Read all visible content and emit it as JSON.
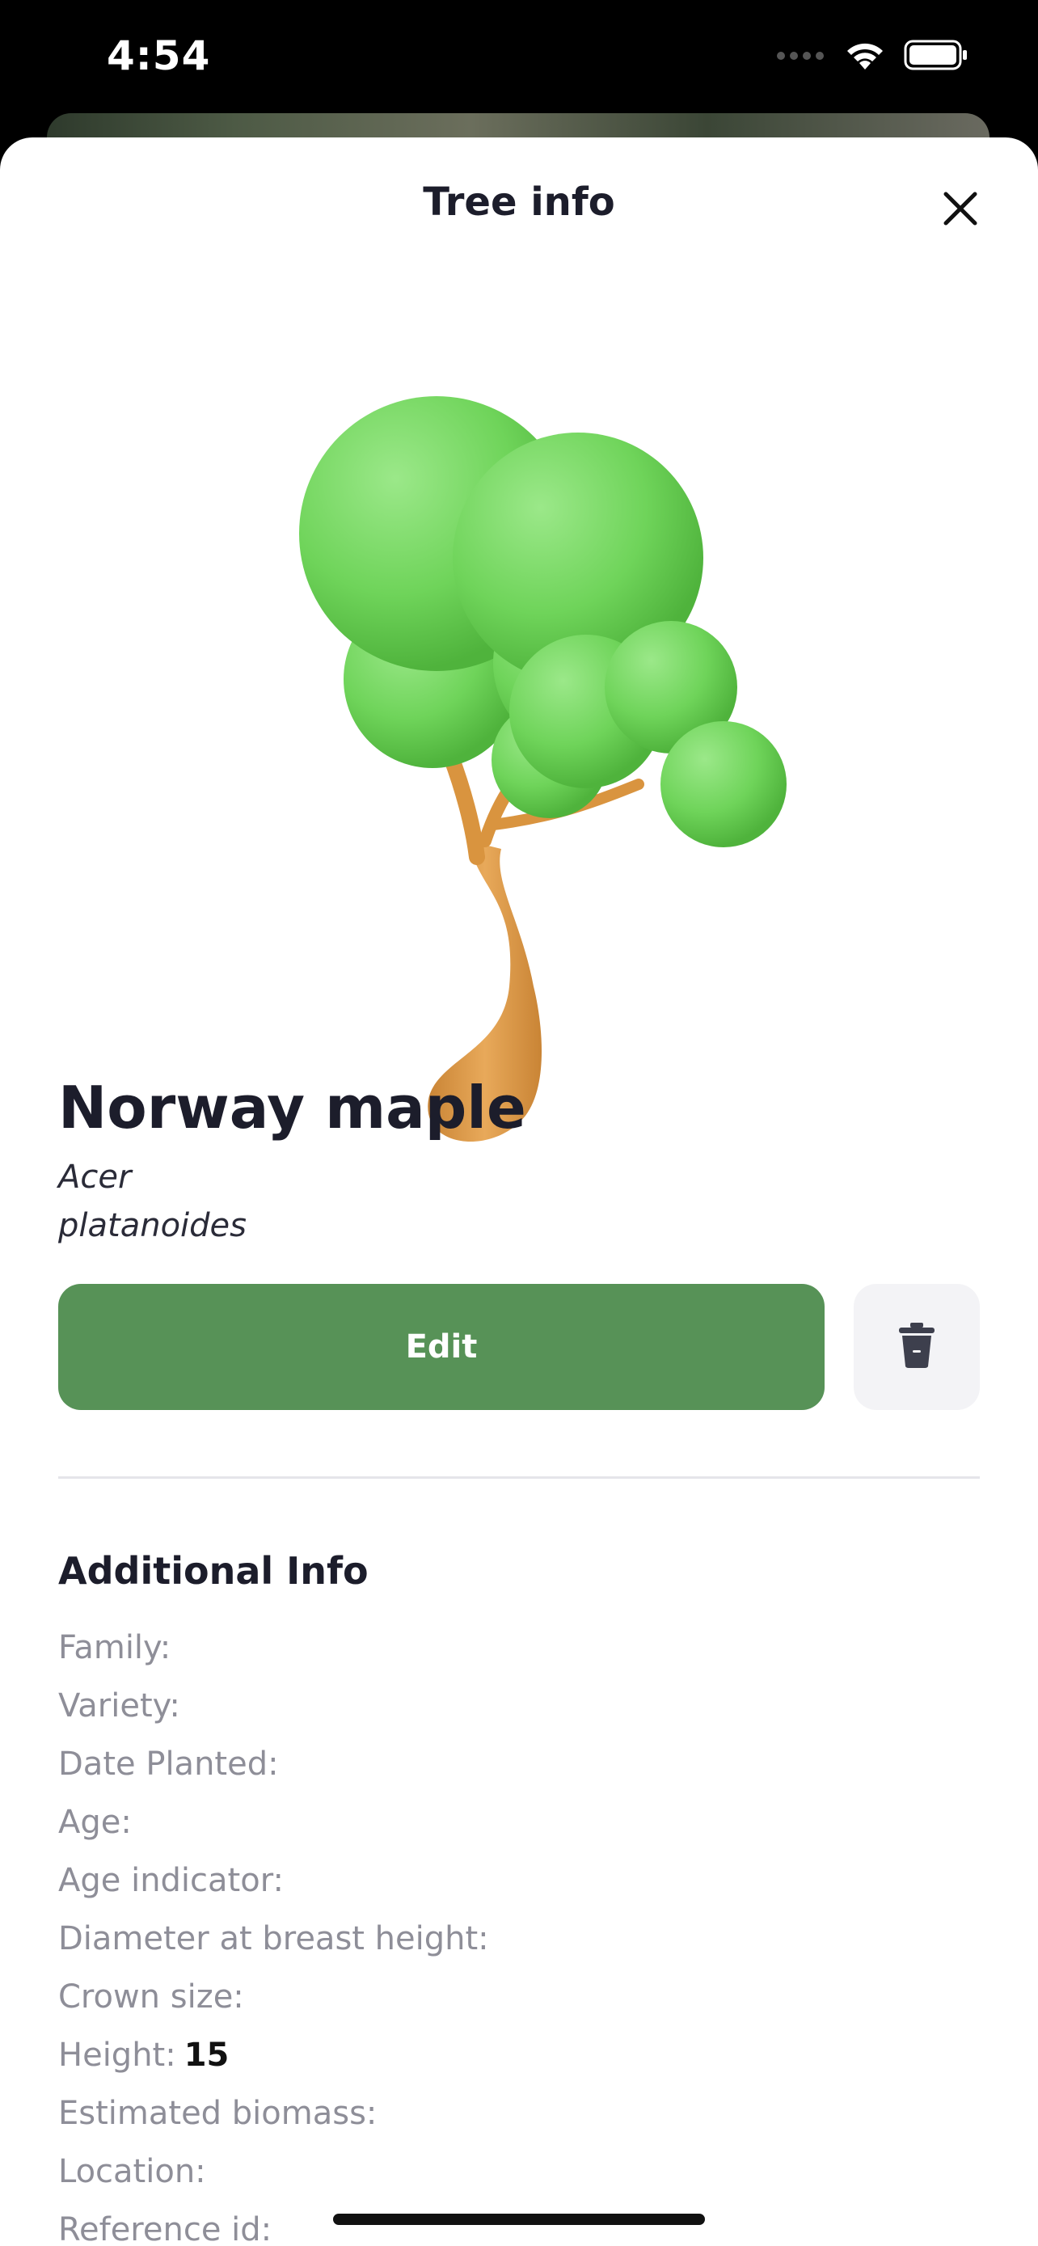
{
  "status_bar": {
    "time": "4:54",
    "icons": [
      "signal-icon",
      "wifi-icon",
      "battery-icon"
    ]
  },
  "sheet": {
    "title": "Tree info",
    "close_icon": "close-icon"
  },
  "tree": {
    "common_name": "Norway maple",
    "scientific_name_line1": "Acer",
    "scientific_name_line2": "platanoides",
    "illustration": "tree-illustration"
  },
  "actions": {
    "edit_label": "Edit",
    "delete_icon": "trash-icon"
  },
  "additional_info": {
    "heading": "Additional Info",
    "rows": [
      {
        "label": "Family:",
        "value": ""
      },
      {
        "label": "Variety:",
        "value": ""
      },
      {
        "label": "Date Planted:",
        "value": ""
      },
      {
        "label": "Age:",
        "value": ""
      },
      {
        "label": "Age indicator:",
        "value": ""
      },
      {
        "label": "Diameter at breast height:",
        "value": ""
      },
      {
        "label": "Crown size:",
        "value": ""
      },
      {
        "label": "Height:",
        "value": "15"
      },
      {
        "label": "Estimated biomass:",
        "value": ""
      },
      {
        "label": "Location:",
        "value": ""
      },
      {
        "label": "Reference id:",
        "value": ""
      }
    ]
  },
  "colors": {
    "accent_green": "#579257",
    "foliage_green": "#6fd45a",
    "trunk_orange": "#e0a050",
    "text_dark": "#1c1d2b",
    "text_muted": "#8e8e98"
  }
}
